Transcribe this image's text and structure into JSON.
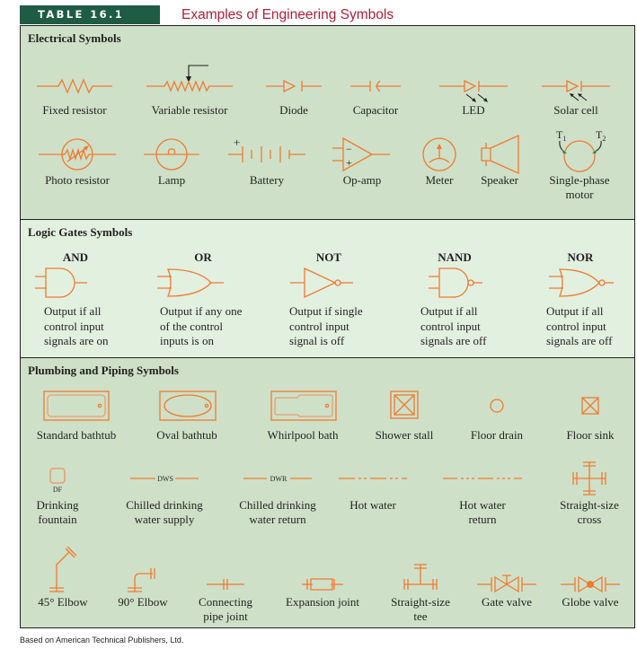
{
  "header": {
    "table_label": "TABLE 16.1",
    "title": "Examples of Engineering Symbols"
  },
  "colors": {
    "header_bg": "#1e5c45",
    "title_red": "#b01e3a",
    "symbol_orange": "#f07a30",
    "section_green": "#cee0c8",
    "section_light_green": "#e2f0e0",
    "motor_arrow_green": "#1e8a5a"
  },
  "electrical": {
    "title": "Electrical Symbols",
    "row1": [
      {
        "icon": "fixed-resistor-icon",
        "label": "Fixed resistor"
      },
      {
        "icon": "variable-resistor-icon",
        "label": "Variable resistor"
      },
      {
        "icon": "diode-icon",
        "label": "Diode"
      },
      {
        "icon": "capacitor-icon",
        "label": "Capacitor"
      },
      {
        "icon": "led-icon",
        "label": "LED"
      },
      {
        "icon": "solar-cell-icon",
        "label": "Solar cell"
      }
    ],
    "row2": [
      {
        "icon": "photo-resistor-icon",
        "label": "Photo resistor"
      },
      {
        "icon": "lamp-icon",
        "label": "Lamp"
      },
      {
        "icon": "battery-icon",
        "label": "Battery",
        "sign": "+"
      },
      {
        "icon": "op-amp-icon",
        "label": "Op-amp",
        "minus": "−",
        "plus": "+"
      },
      {
        "icon": "meter-icon",
        "label": "Meter"
      },
      {
        "icon": "speaker-icon",
        "label": "Speaker"
      },
      {
        "icon": "single-phase-motor-icon",
        "label_line1": "Single-phase",
        "label_line2": "motor",
        "t1": "T",
        "t1_sub": "1",
        "t2": "T",
        "t2_sub": "2"
      }
    ]
  },
  "logic": {
    "title": "Logic Gates Symbols",
    "gates": [
      {
        "name": "AND",
        "icon": "and-gate-icon",
        "desc": [
          "Output if all",
          "control input",
          "signals are on"
        ]
      },
      {
        "name": "OR",
        "icon": "or-gate-icon",
        "desc": [
          "Output if any one",
          "of the control",
          "inputs is on"
        ]
      },
      {
        "name": "NOT",
        "icon": "not-gate-icon",
        "desc": [
          "Output if single",
          "control input",
          "signal is off"
        ]
      },
      {
        "name": "NAND",
        "icon": "nand-gate-icon",
        "desc": [
          "Output if all",
          "control input",
          "signals are off"
        ]
      },
      {
        "name": "NOR",
        "icon": "nor-gate-icon",
        "desc": [
          "Output if all",
          "control input",
          "signals are off"
        ]
      }
    ]
  },
  "plumbing": {
    "title": "Plumbing and Piping Symbols",
    "row1": [
      {
        "icon": "standard-bathtub-icon",
        "label": "Standard bathtub"
      },
      {
        "icon": "oval-bathtub-icon",
        "label": "Oval bathtub"
      },
      {
        "icon": "whirlpool-bath-icon",
        "label": "Whirlpool bath"
      },
      {
        "icon": "shower-stall-icon",
        "label": "Shower stall"
      },
      {
        "icon": "floor-drain-icon",
        "label": "Floor drain"
      },
      {
        "icon": "floor-sink-icon",
        "label": "Floor sink"
      }
    ],
    "row2": [
      {
        "icon": "drinking-fountain-icon",
        "tag": "DF",
        "label_line1": "Drinking",
        "label_line2": "fountain"
      },
      {
        "icon": "chilled-water-supply-icon",
        "tag": "DWS",
        "label_line1": "Chilled drinking",
        "label_line2": "water supply"
      },
      {
        "icon": "chilled-water-return-icon",
        "tag": "DWR",
        "label_line1": "Chilled drinking",
        "label_line2": "water return"
      },
      {
        "icon": "hot-water-icon",
        "label_line1": "Hot water",
        "label_line2": ""
      },
      {
        "icon": "hot-water-return-icon",
        "label_line1": "Hot water",
        "label_line2": "return"
      },
      {
        "icon": "straight-size-cross-icon",
        "label_line1": "Straight-size",
        "label_line2": "cross"
      }
    ],
    "row3": [
      {
        "icon": "elbow-45-icon",
        "label_line1": "45° Elbow",
        "label_line2": ""
      },
      {
        "icon": "elbow-90-icon",
        "label_line1": "90° Elbow",
        "label_line2": ""
      },
      {
        "icon": "connecting-pipe-joint-icon",
        "label_line1": "Connecting",
        "label_line2": "pipe joint"
      },
      {
        "icon": "expansion-joint-icon",
        "label_line1": "Expansion joint",
        "label_line2": ""
      },
      {
        "icon": "straight-size-tee-icon",
        "label_line1": "Straight-size",
        "label_line2": "tee"
      },
      {
        "icon": "gate-valve-icon",
        "label_line1": "Gate valve",
        "label_line2": ""
      },
      {
        "icon": "globe-valve-icon",
        "label_line1": "Globe valve",
        "label_line2": ""
      }
    ]
  },
  "footer": {
    "credit": "Based on American Technical Publishers, Ltd."
  }
}
